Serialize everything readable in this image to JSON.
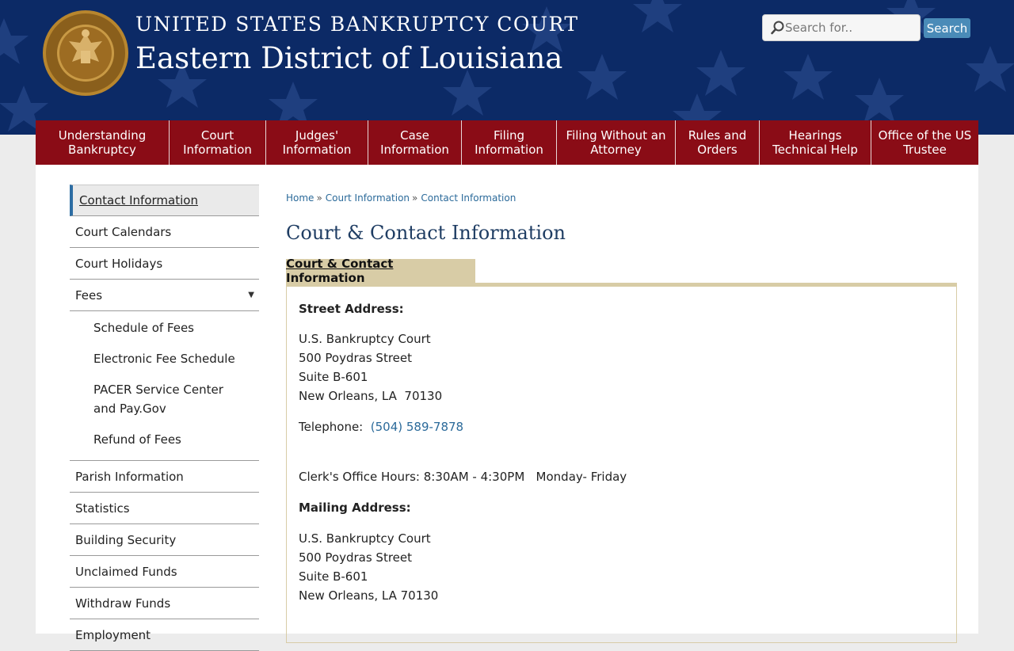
{
  "header": {
    "court_name": "UNITED STATES BANKRUPTCY COURT",
    "district_name": "Eastern District of Louisiana",
    "seal_text": "UNITED STATES BANKRUPTCY COURT · EASTERN DISTRICT OF LOUISIANA",
    "search": {
      "placeholder": "Search for..",
      "button_label": "Search"
    }
  },
  "nav": {
    "items": [
      {
        "label": "Understanding Bankruptcy"
      },
      {
        "label": "Court Information"
      },
      {
        "label": "Judges' Information"
      },
      {
        "label": "Case Information"
      },
      {
        "label": "Filing Information"
      },
      {
        "label": "Filing Without an Attorney"
      },
      {
        "label": "Rules and Orders"
      },
      {
        "label": "Hearings Technical Help"
      },
      {
        "label": "Office of the US Trustee"
      }
    ]
  },
  "sidebar": {
    "items": [
      {
        "label": "Contact Information"
      },
      {
        "label": "Court Calendars"
      },
      {
        "label": "Court Holidays"
      },
      {
        "label": "Fees"
      },
      {
        "label": "Parish Information"
      },
      {
        "label": "Statistics"
      },
      {
        "label": "Building Security"
      },
      {
        "label": "Unclaimed Funds"
      },
      {
        "label": "Withdraw Funds"
      },
      {
        "label": "Employment"
      }
    ],
    "fees_sub": [
      {
        "label": "Schedule of Fees"
      },
      {
        "label": "Electronic Fee Schedule"
      },
      {
        "label": "PACER Service Center and Pay.Gov"
      },
      {
        "label": "Refund of Fees"
      }
    ],
    "fees_arrow": "▼"
  },
  "breadcrumb": {
    "items": [
      "Home",
      "Court Information",
      "Contact Information"
    ],
    "separator": "»"
  },
  "main": {
    "title": "Court & Contact Information",
    "tab_label": "Court & Contact Information",
    "street_heading": "Street Address:",
    "street_lines": [
      "U.S. Bankruptcy Court",
      "500 Poydras Street",
      "Suite B-601",
      "New Orleans, LA  70130"
    ],
    "telephone_label": "Telephone:",
    "telephone_number": "(504) 589-7878",
    "hours": "Clerk's Office Hours: 8:30AM - 4:30PM   Monday- Friday",
    "mailing_heading": "Mailing Address:",
    "mailing_lines": [
      "U.S. Bankruptcy Court",
      "500 Poydras Street",
      "Suite B-601",
      "New Orleans, LA 70130"
    ]
  },
  "colors": {
    "header_bg": "#0c2a66",
    "nav_bg": "#8a0c16",
    "tab_bg": "#d8cca6",
    "link": "#2b6a9a",
    "active_marker": "#2d6da3"
  }
}
